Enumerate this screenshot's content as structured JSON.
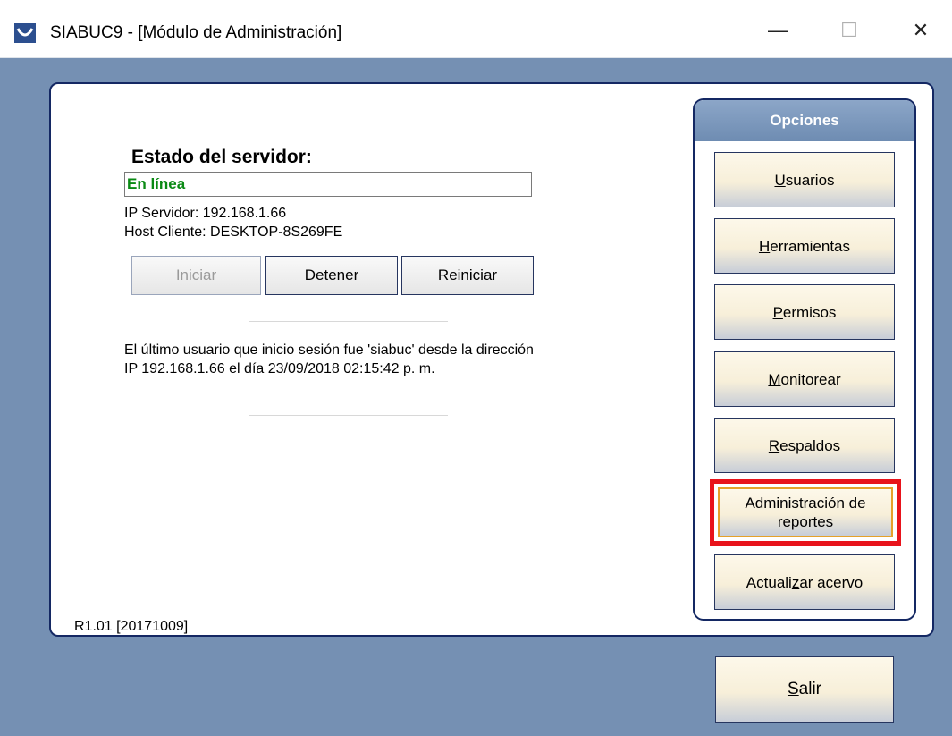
{
  "window": {
    "title": "SIABUC9 - [Módulo de Administración]",
    "minimize": "—",
    "maximize": "☐",
    "close": "✕"
  },
  "server": {
    "heading": "Estado del servidor:",
    "status": "En línea",
    "status_color": "#0a8a14",
    "ip_line": "IP Servidor: 192.168.1.66",
    "host_line": "Host Cliente: DESKTOP-8S269FE",
    "buttons": {
      "start": "Iniciar",
      "stop": "Detener",
      "restart": "Reiniciar"
    },
    "last_login_line1": "El último usuario que inicio sesión fue 'siabuc' desde la dirección",
    "last_login_line2": "IP  192.168.1.66 el día  23/09/2018 02:15:42 p. m."
  },
  "version": "R1.01 [20171009]",
  "options": {
    "header": "Opciones",
    "items": [
      {
        "pre": "",
        "key": "U",
        "post": "suarios"
      },
      {
        "pre": "",
        "key": "H",
        "post": "erramientas"
      },
      {
        "pre": "",
        "key": "P",
        "post": "ermisos"
      },
      {
        "pre": "",
        "key": "M",
        "post": "onitorear"
      },
      {
        "pre": "",
        "key": "R",
        "post": "espaldos"
      },
      {
        "line1": "Administración de",
        "line2": "reportes"
      },
      {
        "pre": "Actuali",
        "key": "z",
        "post": "ar acervo"
      }
    ]
  },
  "exit": {
    "key": "S",
    "post": "alir"
  },
  "colors": {
    "client_bg": "#7590b3",
    "panel_border": "#142863",
    "highlight": "#e8131b"
  }
}
